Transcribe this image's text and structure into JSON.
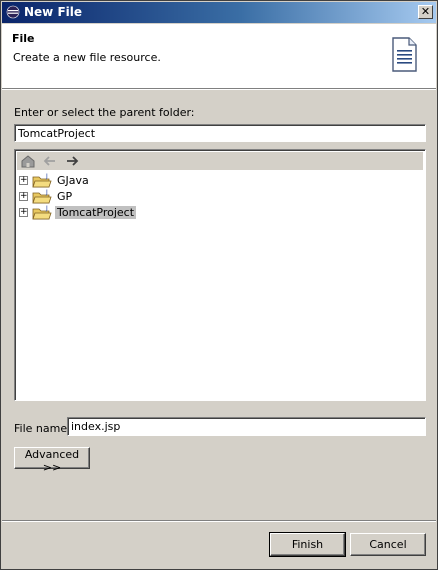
{
  "window": {
    "title": "New File",
    "close_glyph": "✕"
  },
  "banner": {
    "title": "File",
    "description": "Create a new file resource.",
    "icon": "document-icon"
  },
  "parent_folder": {
    "label": "Enter or select the parent folder:",
    "value": "TomcatProject"
  },
  "tree": {
    "toolbar": [
      "home-icon",
      "back-arrow-icon",
      "forward-arrow-icon"
    ],
    "items": [
      {
        "label": "GJava",
        "selected": false
      },
      {
        "label": "GP",
        "selected": false
      },
      {
        "label": "TomcatProject",
        "selected": true
      }
    ]
  },
  "file_name": {
    "label": "File name:",
    "value": "index.jsp"
  },
  "buttons": {
    "advanced": "Advanced >>",
    "finish": "Finish",
    "cancel": "Cancel"
  }
}
